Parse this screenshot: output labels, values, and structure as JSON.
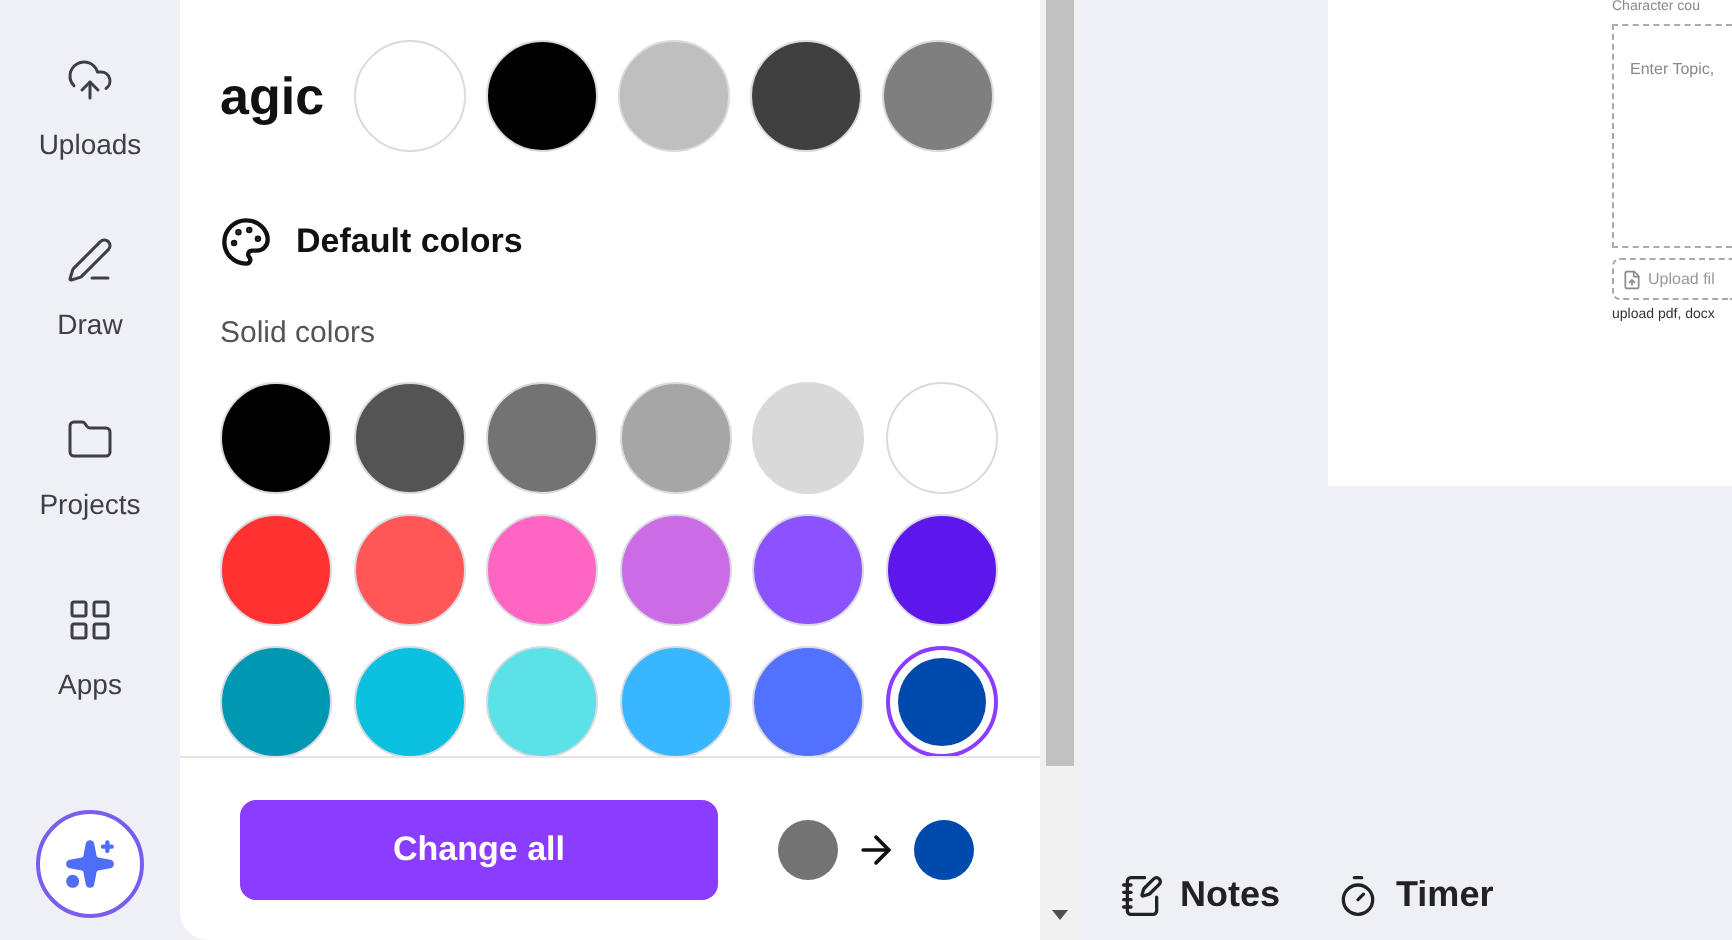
{
  "sidebar": {
    "items": [
      {
        "kind": "uploads",
        "label": "Uploads"
      },
      {
        "kind": "draw",
        "label": "Draw"
      },
      {
        "kind": "projects",
        "label": "Projects"
      },
      {
        "kind": "apps",
        "label": "Apps"
      }
    ]
  },
  "color_panel": {
    "brand_name": "agic",
    "brand_colors": [
      {
        "color": "#ffffff",
        "selected": false
      },
      {
        "color": "#000000",
        "selected": false
      },
      {
        "color": "#bfbfbf",
        "selected": false
      },
      {
        "color": "#404040",
        "selected": false
      },
      {
        "color": "#7f7f7f",
        "selected": false
      }
    ],
    "default_heading": "Default colors",
    "solid_heading": "Solid colors",
    "solid_colors": [
      {
        "color": "#000000",
        "selected": false
      },
      {
        "color": "#545454",
        "selected": false
      },
      {
        "color": "#737373",
        "selected": false
      },
      {
        "color": "#a6a6a6",
        "selected": false
      },
      {
        "color": "#d9d9d9",
        "selected": false
      },
      {
        "color": "#ffffff",
        "selected": false
      },
      {
        "color": "#ff3131",
        "selected": false
      },
      {
        "color": "#ff5757",
        "selected": false
      },
      {
        "color": "#ff66c4",
        "selected": false
      },
      {
        "color": "#cb6ce6",
        "selected": false
      },
      {
        "color": "#8c52ff",
        "selected": false
      },
      {
        "color": "#5e17eb",
        "selected": false
      },
      {
        "color": "#0097b2",
        "selected": false
      },
      {
        "color": "#0cc0df",
        "selected": false
      },
      {
        "color": "#5ce1e6",
        "selected": false
      },
      {
        "color": "#38b6ff",
        "selected": false
      },
      {
        "color": "#5271ff",
        "selected": false
      },
      {
        "color": "#004aad",
        "selected": true
      }
    ],
    "change_all_button": "Change all",
    "from_color": {
      "color": "#737373"
    },
    "to_color": {
      "color": "#004aad"
    }
  },
  "canvas_page": {
    "character_label": "Character cou",
    "topic_placeholder": "Enter Topic,",
    "upload_button": "Upload fil",
    "upload_hint": "upload pdf, docx"
  },
  "bottom_bar": [
    {
      "kind": "notes",
      "label": "Notes"
    },
    {
      "kind": "timer",
      "label": "Timer"
    }
  ]
}
